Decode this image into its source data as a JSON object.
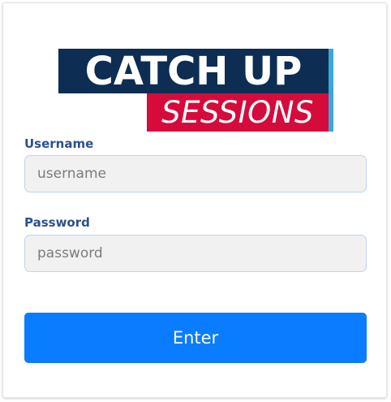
{
  "logo": {
    "line1": "CATCH UP",
    "line2": "SESSIONS"
  },
  "form": {
    "username_label": "Username",
    "username_placeholder": "username",
    "username_value": "",
    "password_label": "Password",
    "password_placeholder": "password",
    "password_value": "",
    "submit_label": "Enter"
  },
  "colors": {
    "logo_navy": "#0d2d52",
    "logo_red": "#d50b3c",
    "logo_stripe": "#3aa7dc",
    "label_text": "#2f4f8f",
    "button_bg": "#0a7cff"
  }
}
